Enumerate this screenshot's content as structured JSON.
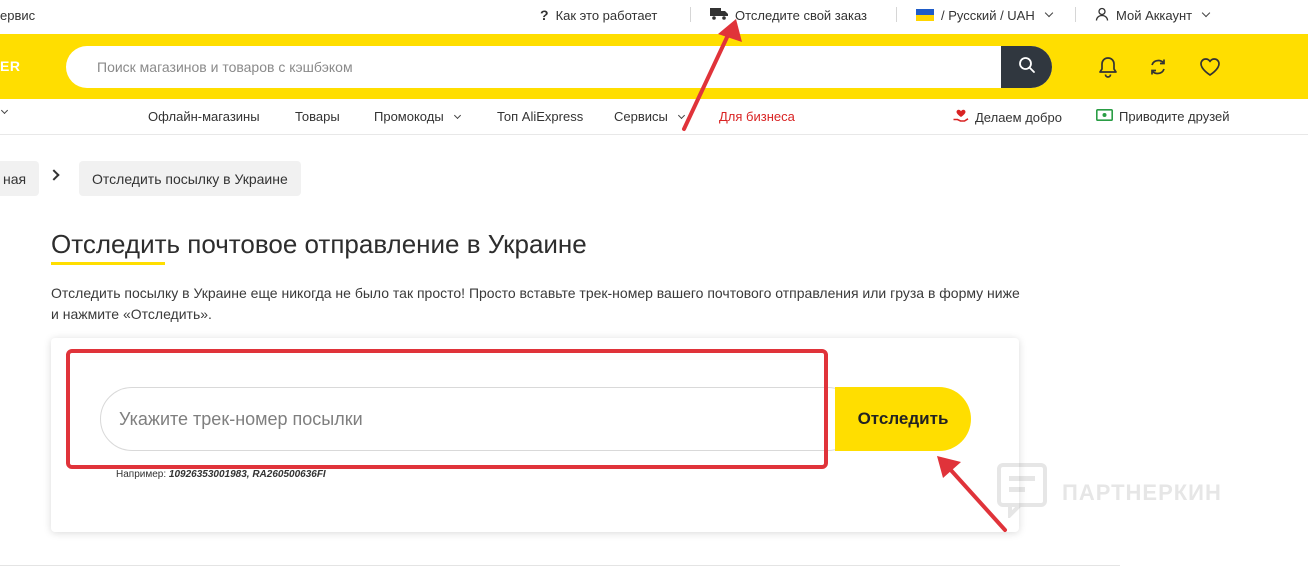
{
  "topbar": {
    "service_fragment": "ервис",
    "how_it_works": "Как это работает",
    "track_order": "Отследите свой заказ",
    "locale": "/ Русский / UAH",
    "account": "Мой Аккаунт"
  },
  "header": {
    "logo_fragment": "ER",
    "search_placeholder": "Поиск магазинов и товаров с кэшбэком"
  },
  "nav": {
    "items": [
      "Офлайн-магазины",
      "Товары",
      "Промокоды",
      "Топ AliExpress",
      "Сервисы",
      "Для бизнеса"
    ],
    "right_items": [
      "Делаем добро",
      "Приводите друзей"
    ]
  },
  "breadcrumb": {
    "home_fragment": "ная",
    "current": "Отследить посылку в Украине"
  },
  "page": {
    "title": "Отследить почтовое отправление в Украине",
    "description": "Отследить посылку в Украине еще никогда не было так просто! Просто вставьте трек-номер вашего почтового отправления или груза в форму ниже и нажмите «Отследить»."
  },
  "tracker": {
    "placeholder": "Укажите трек-номер посылки",
    "button": "Отследить",
    "example_label": "Например:",
    "example_values": "10926353001983, RA260500636FI"
  },
  "watermark": {
    "text": "ПАРТНЕРКИН"
  },
  "colors": {
    "accent": "#ffde00",
    "dark": "#30373f",
    "annotation": "#e0333a",
    "business": "#d92323"
  }
}
